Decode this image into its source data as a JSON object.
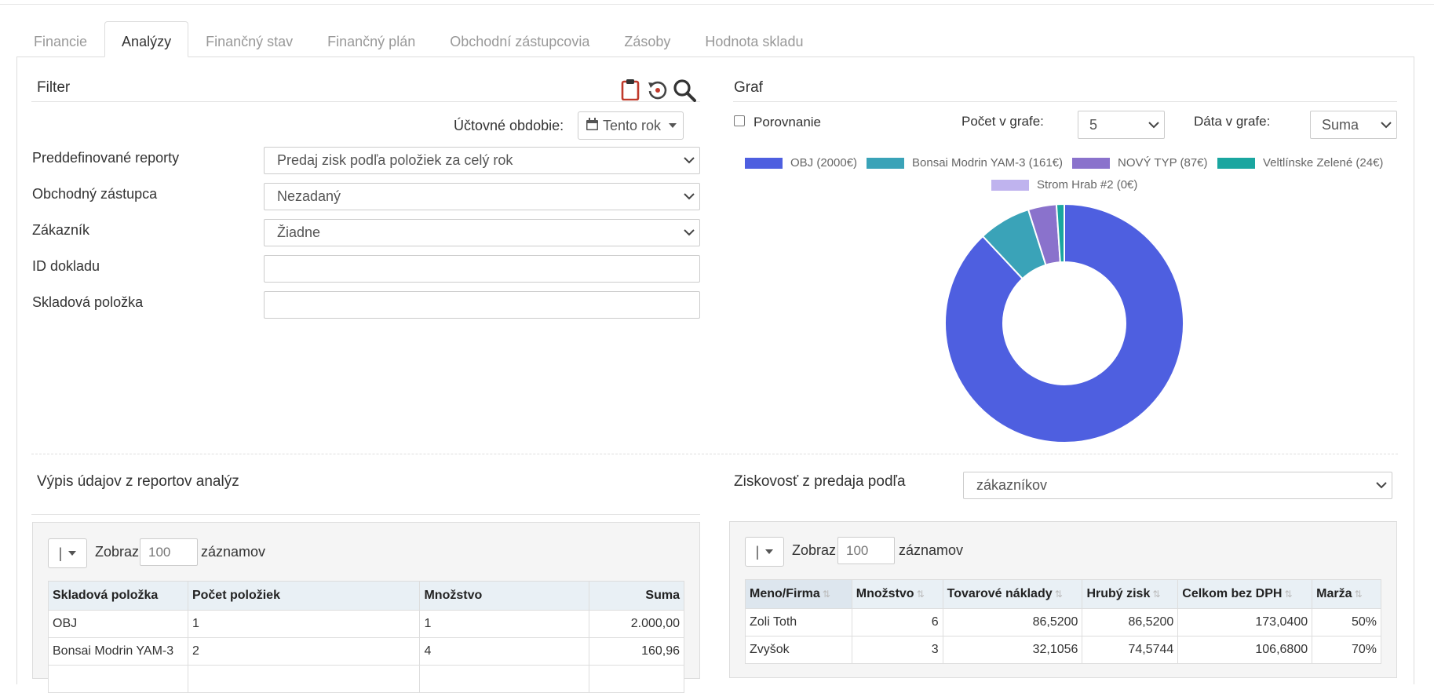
{
  "tabs": [
    {
      "label": "Financie",
      "active": false
    },
    {
      "label": "Analýzy",
      "active": true
    },
    {
      "label": "Finančný stav",
      "active": false
    },
    {
      "label": "Finančný plán",
      "active": false
    },
    {
      "label": "Obchodní zástupcovia",
      "active": false
    },
    {
      "label": "Zásoby",
      "active": false
    },
    {
      "label": "Hodnota skladu",
      "active": false
    }
  ],
  "filter": {
    "title": "Filter",
    "icons": [
      "clipboard-icon",
      "reset-icon",
      "search-icon"
    ],
    "period_label": "Účtovné obdobie:",
    "period_value": "Tento rok",
    "fields": {
      "reports_label": "Preddefinované reporty",
      "reports_value": "Predaj zisk podľa položiek za celý rok",
      "agent_label": "Obchodný zástupca",
      "agent_value": "Nezadaný",
      "customer_label": "Zákazník",
      "customer_value": "Žiadne",
      "doc_id_label": "ID dokladu",
      "doc_id_value": "",
      "stock_item_label": "Skladová položka",
      "stock_item_value": ""
    }
  },
  "graph": {
    "title": "Graf",
    "comparison_label": "Porovnanie",
    "count_label": "Počet v grafe:",
    "count_value": "5",
    "data_label": "Dáta v grafe:",
    "data_value": "Suma"
  },
  "chart_data": {
    "type": "pie",
    "donut": true,
    "categories": [
      "OBJ (2000€)",
      "Bonsai Modrin YAM-3 (161€)",
      "NOVÝ TYP (87€)",
      "Veltlínske Zelené (24€)",
      "Strom Hrab #2 (0€)"
    ],
    "values": [
      2000,
      161,
      87,
      24,
      0
    ],
    "colors": [
      "#4e5fe0",
      "#3aa3b8",
      "#8a72cc",
      "#1aa6a0",
      "#bfb3ee"
    ],
    "legend_position": "top"
  },
  "analysis_list": {
    "title": "Výpis údajov z reportov analýz",
    "show_label": "Zobraz",
    "page_size": "100",
    "records_label": "záznamov",
    "dropdown_label": "|",
    "columns": [
      "Skladová položka",
      "Počet položiek",
      "Množstvo",
      "Suma"
    ],
    "rows": [
      [
        "OBJ",
        "1",
        "1",
        "2.000,00"
      ],
      [
        "Bonsai Modrin YAM-3",
        "2",
        "4",
        "160,96"
      ]
    ]
  },
  "profitability": {
    "title": "Ziskovosť z predaja podľa",
    "by_value": "zákazníkov",
    "show_label": "Zobraz",
    "page_size": "100",
    "records_label": "záznamov",
    "dropdown_label": "|",
    "columns": [
      "Meno/Firma",
      "Množstvo",
      "Tovarové náklady",
      "Hrubý zisk",
      "Celkom bez DPH",
      "Marža"
    ],
    "rows": [
      [
        "Zoli Toth",
        "6",
        "86,5200",
        "86,5200",
        "173,0400",
        "50%"
      ],
      [
        "Zvyšok",
        "3",
        "32,1056",
        "74,5744",
        "106,6800",
        "70%"
      ]
    ]
  }
}
